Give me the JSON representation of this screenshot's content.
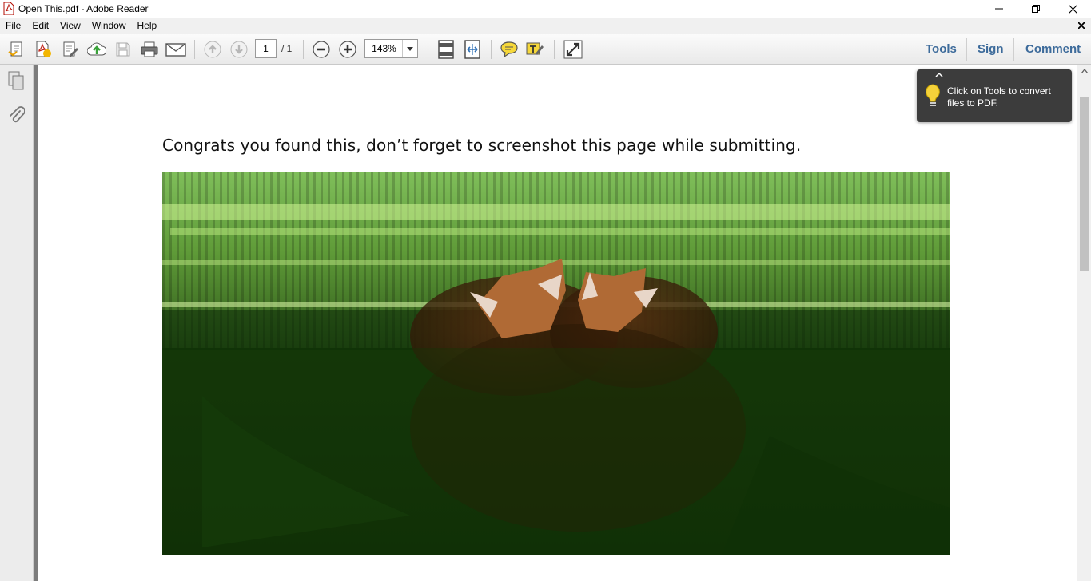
{
  "window": {
    "title": "Open This.pdf - Adobe Reader",
    "controls": [
      "minimize",
      "restore",
      "close"
    ]
  },
  "menu": {
    "items": [
      "File",
      "Edit",
      "View",
      "Window",
      "Help"
    ]
  },
  "toolbar": {
    "page_number": "1",
    "page_total": "/ 1",
    "zoom": "143%",
    "right_links": [
      "Tools",
      "Sign",
      "Comment"
    ]
  },
  "tooltip": {
    "text": "Click on Tools to convert files to PDF."
  },
  "document": {
    "text": "Congrats you found this, don’t forget to screenshot this page while submitting."
  },
  "colors": {
    "link": "#3d6b9b",
    "tooltip_bg": "#3c3c3c",
    "gutter": "#7c7c7c"
  }
}
